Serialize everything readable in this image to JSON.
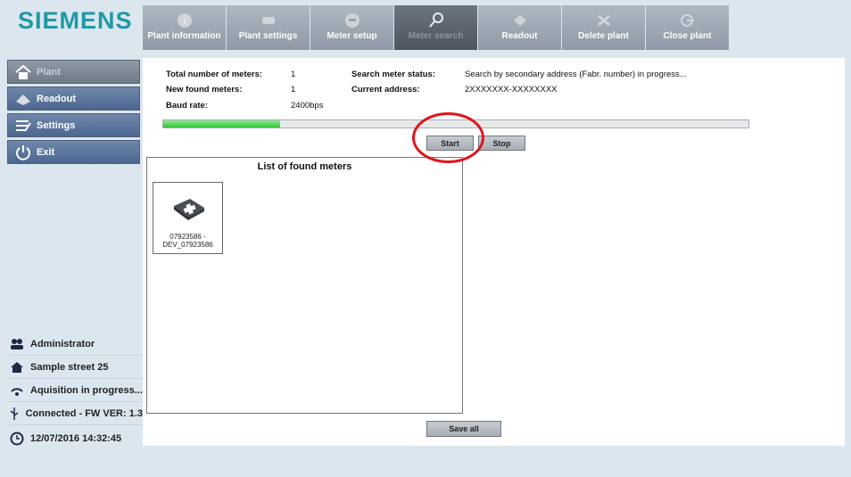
{
  "brand": {
    "logo": "SIEMENS"
  },
  "tabs": [
    {
      "label": "Plant information",
      "icon": "info-icon"
    },
    {
      "label": "Plant settings",
      "icon": "settings-icon"
    },
    {
      "label": "Meter setup",
      "icon": "meter-icon"
    },
    {
      "label": "Meter search",
      "icon": "search-icon",
      "active": true
    },
    {
      "label": "Readout",
      "icon": "readout-icon"
    },
    {
      "label": "Delete plant",
      "icon": "delete-icon"
    },
    {
      "label": "Close plant",
      "icon": "close-icon"
    }
  ],
  "sidebar": {
    "items": [
      {
        "label": "Plant",
        "icon": "home-icon"
      },
      {
        "label": "Readout",
        "icon": "readout-icon"
      },
      {
        "label": "Settings",
        "icon": "settings-icon"
      },
      {
        "label": "Exit",
        "icon": "power-icon"
      }
    ]
  },
  "status": {
    "user": "Administrator",
    "address": "Sample street 25",
    "acquisition": "Aquisition in progress...",
    "connection": "Connected - FW VER: 1.3",
    "datetime": "12/07/2016 14:32:45"
  },
  "search": {
    "total_label": "Total number of meters:",
    "total_value": "1",
    "new_label": "New found meters:",
    "new_value": "1",
    "baud_label": "Baud rate:",
    "baud_value": "2400bps",
    "status_label": "Search meter status:",
    "status_value": "Search by secondary address (Fabr. number) in progress...",
    "address_label": "Current address:",
    "address_value": "2XXXXXXX-XXXXXXXX",
    "progress": 0.2,
    "start_label": "Start",
    "stop_label": "Stop"
  },
  "found_list": {
    "title": "List of found meters",
    "meters": [
      {
        "line1": "07923586 -",
        "line2": "DEV_07923586"
      }
    ]
  },
  "footer": {
    "save_all_label": "Save all"
  },
  "colors": {
    "brand": "#1d9aa6",
    "progress_fill": "#34c13c",
    "highlight_circle": "#e1151c"
  }
}
